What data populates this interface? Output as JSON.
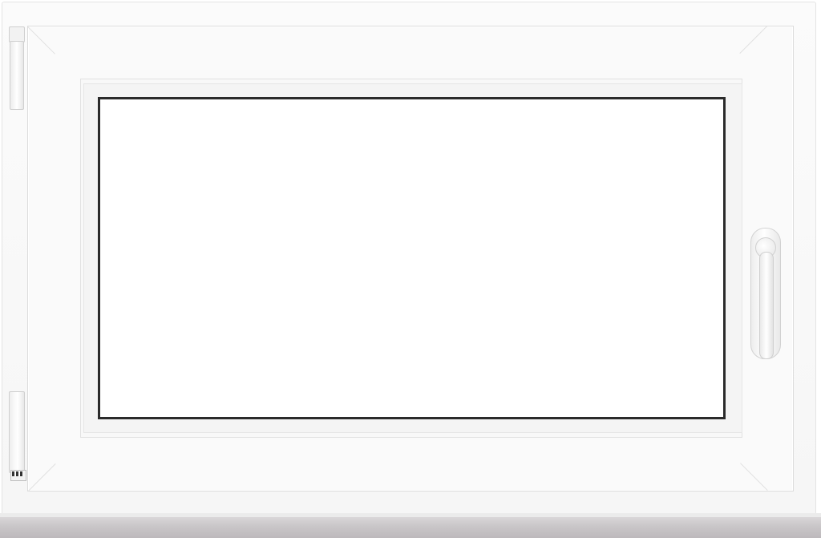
{
  "image": {
    "subject": "window-product",
    "colors": {
      "frame": "#f8f8f8",
      "glass": "#ffffff",
      "gasket": "#2b2b2b",
      "sill": "#c9c6c8"
    },
    "icons": [
      "hinge-icon",
      "handle-icon"
    ]
  }
}
